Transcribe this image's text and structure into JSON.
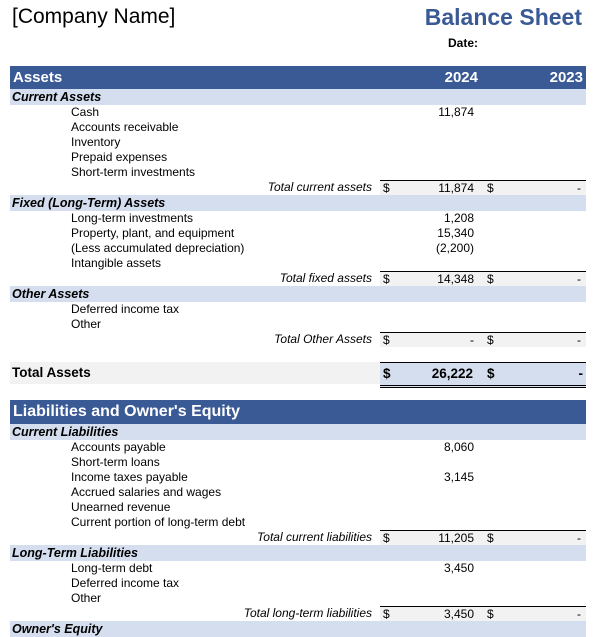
{
  "header": {
    "company_name": "[Company Name]",
    "title": "Balance Sheet",
    "date_label": "Date:"
  },
  "assets": {
    "heading": "Assets",
    "year1": "2024",
    "year2": "2023",
    "current": {
      "label": "Current Assets",
      "items": [
        {
          "label": "Cash",
          "v2024": "11,874",
          "v2023": ""
        },
        {
          "label": "Accounts receivable",
          "v2024": "",
          "v2023": ""
        },
        {
          "label": "Inventory",
          "v2024": "",
          "v2023": ""
        },
        {
          "label": "Prepaid expenses",
          "v2024": "",
          "v2023": ""
        },
        {
          "label": "Short-term investments",
          "v2024": "",
          "v2023": ""
        }
      ],
      "total_label": "Total current assets",
      "total_2024": "11,874",
      "total_2023": "-"
    },
    "fixed": {
      "label": "Fixed (Long-Term) Assets",
      "items": [
        {
          "label": "Long-term investments",
          "v2024": "1,208",
          "v2023": ""
        },
        {
          "label": "Property, plant, and equipment",
          "v2024": "15,340",
          "v2023": ""
        },
        {
          "label": "(Less accumulated depreciation)",
          "v2024": "(2,200)",
          "v2023": ""
        },
        {
          "label": "Intangible assets",
          "v2024": "",
          "v2023": ""
        }
      ],
      "total_label": "Total fixed assets",
      "total_2024": "14,348",
      "total_2023": "-"
    },
    "other": {
      "label": "Other Assets",
      "items": [
        {
          "label": "Deferred income tax",
          "v2024": "",
          "v2023": ""
        },
        {
          "label": "Other",
          "v2024": "",
          "v2023": ""
        }
      ],
      "total_label": "Total Other Assets",
      "total_2024": "-",
      "total_2023": "-"
    },
    "grand_label": "Total Assets",
    "grand_2024": "26,222",
    "grand_2023": "-"
  },
  "liabilities": {
    "heading": "Liabilities and Owner's Equity",
    "current": {
      "label": "Current Liabilities",
      "items": [
        {
          "label": "Accounts payable",
          "v2024": "8,060",
          "v2023": ""
        },
        {
          "label": "Short-term loans",
          "v2024": "",
          "v2023": ""
        },
        {
          "label": "Income taxes payable",
          "v2024": "3,145",
          "v2023": ""
        },
        {
          "label": "Accrued salaries and wages",
          "v2024": "",
          "v2023": ""
        },
        {
          "label": "Unearned revenue",
          "v2024": "",
          "v2023": ""
        },
        {
          "label": "Current portion of long-term debt",
          "v2024": "",
          "v2023": ""
        }
      ],
      "total_label": "Total current liabilities",
      "total_2024": "11,205",
      "total_2023": "-"
    },
    "longterm": {
      "label": "Long-Term Liabilities",
      "items": [
        {
          "label": "Long-term debt",
          "v2024": "3,450",
          "v2023": ""
        },
        {
          "label": "Deferred income tax",
          "v2024": "",
          "v2023": ""
        },
        {
          "label": "Other",
          "v2024": "",
          "v2023": ""
        }
      ],
      "total_label": "Total long-term liabilities",
      "total_2024": "3,450",
      "total_2023": "-"
    },
    "equity": {
      "label": "Owner's Equity"
    }
  },
  "currency_symbol": "$"
}
